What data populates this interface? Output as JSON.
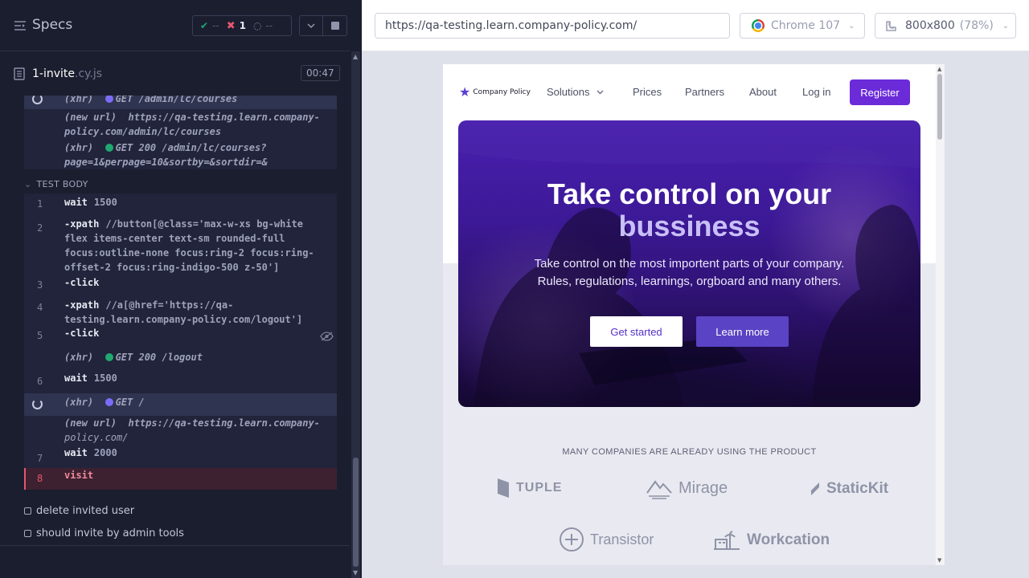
{
  "reporter": {
    "title": "Specs",
    "stats": {
      "passed": "--",
      "failed": "1",
      "pending": "--"
    },
    "spec": {
      "name": "1-invite",
      "ext": ".cy.js",
      "duration": "00:47"
    },
    "log_top": [
      {
        "kind": "xhr",
        "prefix": "(xhr)",
        "text": "GET /admin/lc/courses"
      },
      {
        "kind": "url",
        "prefix": "(new url)",
        "text": "https://qa-testing.learn.company-",
        "text2": "policy.com/admin/lc/courses"
      },
      {
        "kind": "xhr",
        "prefix": "(xhr)",
        "text": "GET 200 /admin/lc/courses?",
        "text2": "page=1&perpage=10&sortby=&sortdir=&"
      }
    ],
    "test_body_label": "TEST BODY",
    "commands": [
      {
        "num": "1",
        "name": "wait",
        "arg": "1500"
      },
      {
        "num": "2",
        "name": "-xpath",
        "arg": "//button[@class='max-w-xs bg-white",
        "lines": [
          "flex items-center text-sm rounded-full",
          "focus:outline-none focus:ring-2 focus:ring-",
          "offset-2 focus:ring-indigo-500 z-50']"
        ]
      },
      {
        "num": "3",
        "name": "-click",
        "arg": ""
      },
      {
        "num": "4",
        "name": "-xpath",
        "arg": "//a[@href='https://qa-",
        "lines": [
          "testing.learn.company-policy.com/logout']"
        ]
      },
      {
        "num": "5",
        "name": "-click",
        "arg": ""
      },
      {
        "num": "",
        "name": "(xhr)",
        "arg": "GET 200 /logout"
      },
      {
        "num": "6",
        "name": "wait",
        "arg": "1500"
      },
      {
        "num": "",
        "name": "(xhr)",
        "arg": "GET /"
      },
      {
        "num": "",
        "name": "(new url)",
        "arg": "https://qa-testing.learn.company-",
        "lines": [
          "policy.com/"
        ]
      },
      {
        "num": "7",
        "name": "wait",
        "arg": "2000"
      },
      {
        "num": "8",
        "name": "visit",
        "arg": ""
      }
    ],
    "tests": [
      "delete invited user",
      "should invite by admin tools"
    ]
  },
  "aut": {
    "url": "https://qa-testing.learn.company-policy.com/",
    "browser": "Chrome 107",
    "viewport": "800x800",
    "zoom": "(78%)",
    "site": {
      "logo_text": "Company Policy",
      "nav": {
        "solutions": "Solutions",
        "prices": "Prices",
        "partners": "Partners",
        "about": "About",
        "login": "Log in",
        "register": "Register"
      },
      "hero_title_1": "Take control on your",
      "hero_title_2": "bussiness",
      "hero_sub_1": "Take control on the most importent parts of your company.",
      "hero_sub_2": "Rules, regulations, learnings, orgboard and many others.",
      "cta_primary": "Get started",
      "cta_secondary": "Learn more",
      "logos_title": "MANY COMPANIES ARE ALREADY USING THE PRODUCT",
      "logos": [
        "TUPLE",
        "Mirage",
        "StaticKit",
        "Transistor",
        "Workcation"
      ]
    }
  },
  "colors": {
    "fail": "#e45770",
    "pass": "#1fa971",
    "accent": "#6b2bd9",
    "xhr_pending": "#7b6cf7"
  }
}
